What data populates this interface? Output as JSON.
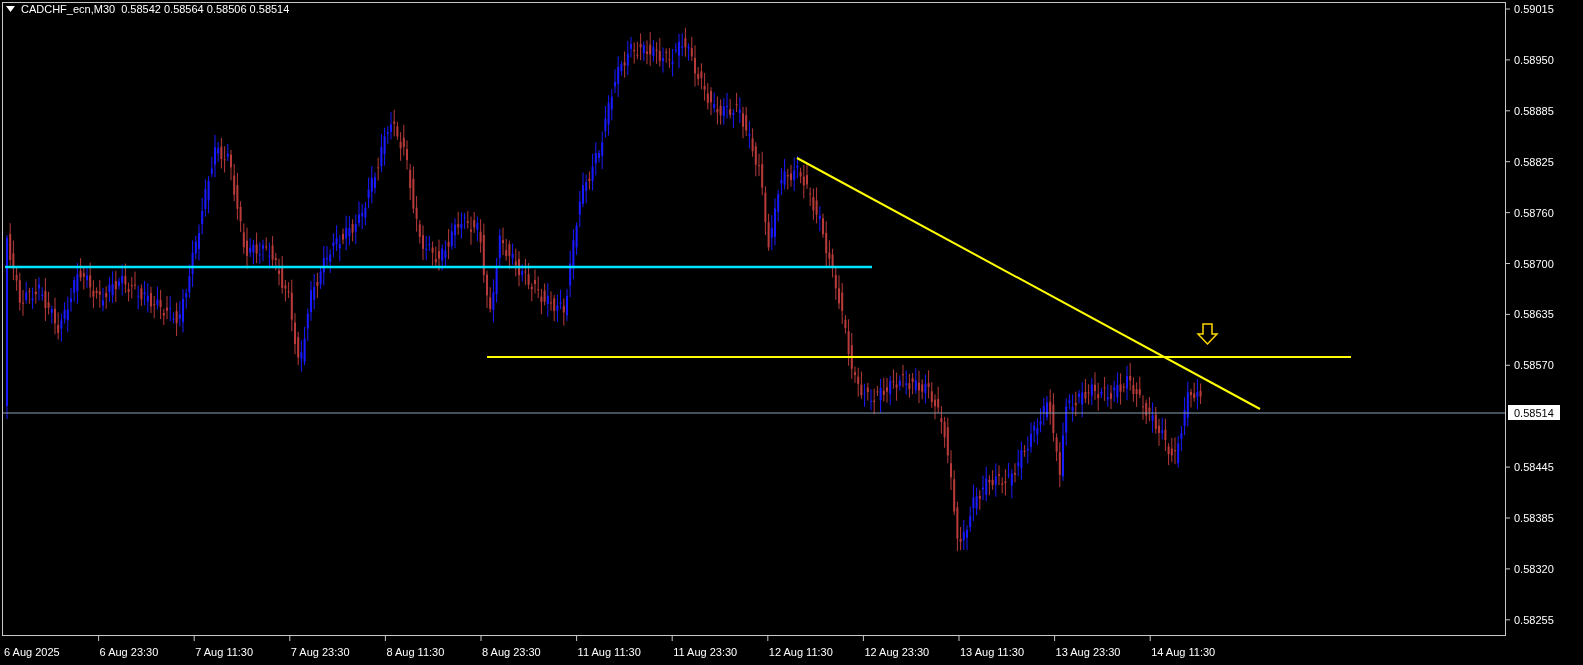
{
  "chart_header": {
    "symbol": "CADCHF_ecn,M30",
    "quote": "0.58542 0.58564 0.58506 0.58514"
  },
  "price_axis": {
    "labels": [
      "0.59015",
      "0.58950",
      "0.58885",
      "0.58825",
      "0.58760",
      "0.58700",
      "0.58635",
      "0.58570",
      "0.58445",
      "0.58385",
      "0.58320",
      "0.58255"
    ],
    "current_price": "0.58514"
  },
  "time_axis": {
    "labels": [
      "6 Aug 2025",
      "6 Aug 23:30",
      "7 Aug 11:30",
      "7 Aug 23:30",
      "8 Aug 11:30",
      "8 Aug 23:30",
      "11 Aug 11:30",
      "11 Aug 23:30",
      "12 Aug 11:30",
      "12 Aug 23:30",
      "13 Aug 11:30",
      "13 Aug 23:30",
      "14 Aug 11:30"
    ]
  }
}
